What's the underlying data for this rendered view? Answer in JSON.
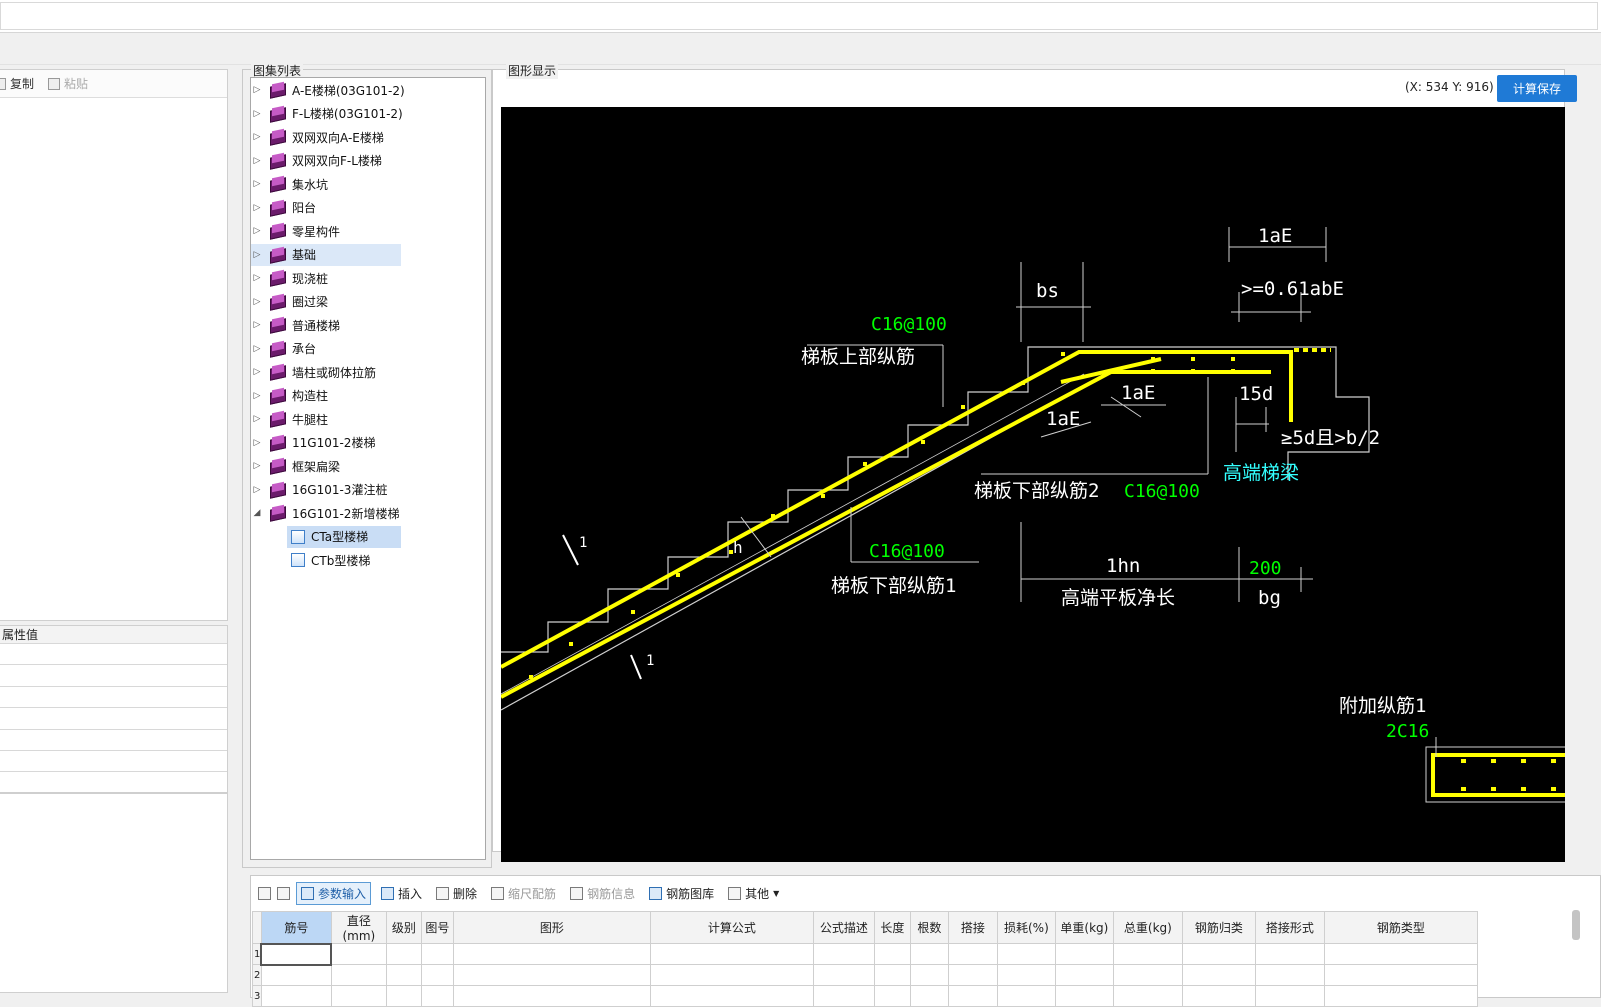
{
  "left_toolbar": {
    "copy": "复制",
    "paste": "粘贴"
  },
  "property_grid": {
    "header": "属性值"
  },
  "tree": {
    "title": "图集列表",
    "items": [
      "A-E楼梯(03G101-2)",
      "F-L楼梯(03G101-2)",
      "双网双向A-E楼梯",
      "双网双向F-L楼梯",
      "集水坑",
      "阳台",
      "零星构件",
      "基础",
      "现浇桩",
      "圈过梁",
      "普通楼梯",
      "承台",
      "墙柱或砌体拉筋",
      "构造柱",
      "牛腿柱",
      "11G101-2楼梯",
      "框架扁梁",
      "16G101-3灌注桩",
      "16G101-2新增楼梯"
    ],
    "children": [
      "CTa型楼梯",
      "CTb型楼梯"
    ]
  },
  "display": {
    "title": "图形显示",
    "coord": "(X: 534 Y: 916)",
    "calc_button": "计算保存"
  },
  "drawing": {
    "laE_top": "1aE",
    "ratio_label": ">=0.61abE",
    "bs": "bs",
    "c16_top": "C16@100",
    "upper_bar": "梯板上部纵筋",
    "laE_mid": "1aE",
    "laE_left": "1aE",
    "d15": "15d",
    "anchor": "≥5d且>b/2",
    "high_beam": "高端梯梁",
    "lower_bar2": "梯板下部纵筋2",
    "c16_lower2": "C16@100",
    "c16_lower1": "C16@100",
    "lower_bar1": "梯板下部纵筋1",
    "lhn": "1hn",
    "plate_len": "高端平板净长",
    "v200": "200",
    "bg": "bg",
    "h": "h",
    "extra_bar": "附加纵筋1",
    "two_c16": "2C16",
    "section_mark": "1"
  },
  "bottom_toolbar": {
    "param_input": "参数输入",
    "insert": "插入",
    "delete": "删除",
    "scale_rebar": "缩尺配筋",
    "rebar_info": "钢筋信息",
    "rebar_library": "钢筋图库",
    "other": "其他"
  },
  "table": {
    "columns": [
      "筋号",
      "直径(mm)",
      "级别",
      "图号",
      "图形",
      "计算公式",
      "公式描述",
      "长度",
      "根数",
      "搭接",
      "损耗(%)",
      "单重(kg)",
      "总重(kg)",
      "钢筋归类",
      "搭接形式",
      "钢筋类型"
    ],
    "rows": [
      "1",
      "2",
      "3"
    ]
  }
}
